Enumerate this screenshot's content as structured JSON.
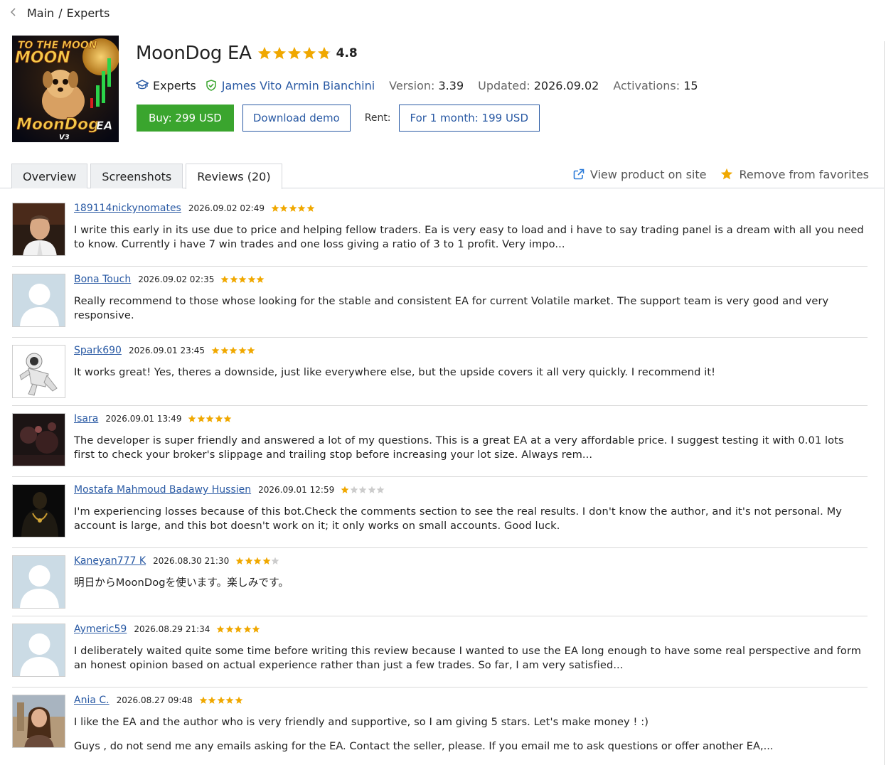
{
  "breadcrumb": {
    "back_icon": "chevron-left-icon",
    "items": [
      "Main",
      "Experts"
    ],
    "separator": "/"
  },
  "product": {
    "logo_text_top": "TO THE MOON",
    "logo_text_main": "MoonDog EA",
    "logo_text_version": "V3",
    "title": "MoonDog EA",
    "rating": 4.8,
    "rating_label": "4.8",
    "category": "Experts",
    "author": "James Vito Armin Bianchini",
    "version_label": "Version:",
    "version": "3.39",
    "updated_label": "Updated:",
    "updated": "2026.09.02",
    "activations_label": "Activations:",
    "activations": "15"
  },
  "actions": {
    "buy": "Buy: 299 USD",
    "demo": "Download demo",
    "rent_label": "Rent:",
    "rent": "For 1 month: 199 USD"
  },
  "tabs": [
    {
      "label": "Overview",
      "active": false
    },
    {
      "label": "Screenshots",
      "active": false
    },
    {
      "label": "Reviews (20)",
      "active": true
    }
  ],
  "tab_actions": {
    "view_product": "View product on site",
    "remove_favorites": "Remove from favorites"
  },
  "colors": {
    "accent_blue": "#2a5aa4",
    "buy_green": "#3aa52e",
    "star_gold": "#f0a800",
    "star_empty": "#cccccc"
  },
  "reviews": [
    {
      "user": "189114nickynomates",
      "date": "2026.09.02 02:49",
      "stars": 5,
      "avatar": "photo-man",
      "text": "I write this early in its use due to price and helping fellow traders. Ea is very easy to load and i have to say trading panel is a dream with all you need to know. Currently i have 7 win trades and one loss giving a ratio of 3 to 1 profit. Very impo...",
      "text2": ""
    },
    {
      "user": "Bona Touch",
      "date": "2026.09.02 02:35",
      "stars": 5,
      "avatar": "default",
      "text": "Really recommend to those whose looking for the stable and consistent EA for current Volatile market. The support team is very good and very responsive.",
      "text2": ""
    },
    {
      "user": "Spark690",
      "date": "2026.09.01 23:45",
      "stars": 5,
      "avatar": "astronaut",
      "text": "It works great! Yes, theres a downside, just like everywhere else, but the upside covers it all very quickly. I recommend it!",
      "text2": ""
    },
    {
      "user": "Isara",
      "date": "2026.09.01 13:49",
      "stars": 5,
      "avatar": "dark-abstract",
      "text": "The developer is super friendly and answered a lot of my questions. This is a great EA at a very affordable price. I suggest testing it with 0.01 lots first to check your broker's slippage and trailing stop before increasing your lot size. Always rem...",
      "text2": ""
    },
    {
      "user": "Mostafa Mahmoud Badawy Hussien",
      "date": "2026.09.01 12:59",
      "stars": 1,
      "avatar": "dark-figure",
      "text": "I'm experiencing losses because of this bot.Check the comments section to see the real results. I don't know the author, and it's not personal. My account is large, and this bot doesn't work on it; it only works on small accounts. Good luck.",
      "text2": ""
    },
    {
      "user": "Kaneyan777 K",
      "date": "2026.08.30 21:30",
      "stars": 4,
      "avatar": "default",
      "text": "明日からMoonDogを使います。楽しみです。",
      "text2": ""
    },
    {
      "user": "Aymeric59",
      "date": "2026.08.29 21:34",
      "stars": 5,
      "avatar": "default",
      "text": "I deliberately waited quite some time before writing this review because I wanted to use the EA long enough to have some real perspective and form an honest opinion based on actual experience rather than just a few trades. So far, I am very satisfied...",
      "text2": ""
    },
    {
      "user": "Ania C.",
      "date": "2026.08.27 09:48",
      "stars": 5,
      "avatar": "photo-woman",
      "text": "I like the EA and the author who is very friendly and supportive, so I am giving 5 stars. Let's make money ! :)",
      "text2": "Guys , do not send me any emails asking for the EA. Contact the seller, please. If you email me to ask questions or offer another EA,..."
    }
  ]
}
